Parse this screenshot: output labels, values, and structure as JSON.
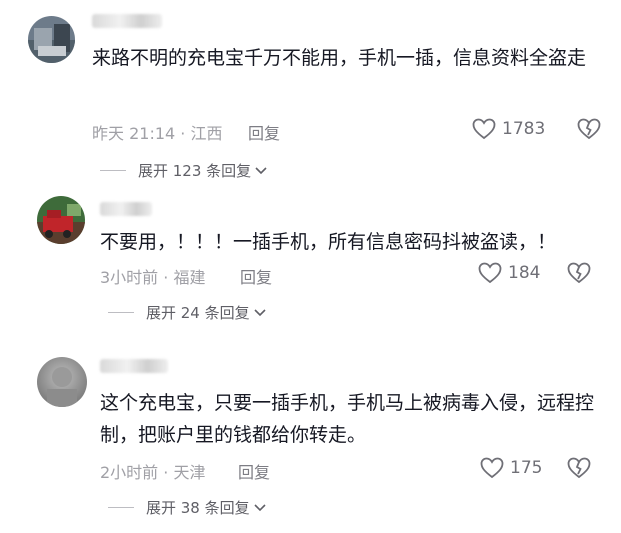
{
  "comments": [
    {
      "text": "来路不明的充电宝千万不能用，手机一插，信息资料全盗走",
      "meta": "昨天 21:14 · 江西",
      "reply_label": "回复",
      "likes": "1783",
      "expand": "展开 123 条回复"
    },
    {
      "text": "不要用，！！！一插手机，所有信息密码抖被盗读，！",
      "meta": "3小时前 · 福建",
      "reply_label": "回复",
      "likes": "184",
      "expand": "展开 24 条回复"
    },
    {
      "text": "这个充电宝，只要一插手机，手机马上被病毒入侵，远程控制，把账户里的钱都给你转走。",
      "meta": "2小时前 · 天津",
      "reply_label": "回复",
      "likes": "175",
      "expand": "展开 38 条回复"
    }
  ],
  "icons": {
    "like": "heart-outline-icon",
    "dislike": "broken-heart-icon",
    "expand": "chevron-down-icon"
  },
  "colors": {
    "text": "#161823",
    "meta": "#a0a0a6",
    "icon": "#6f6f76"
  }
}
